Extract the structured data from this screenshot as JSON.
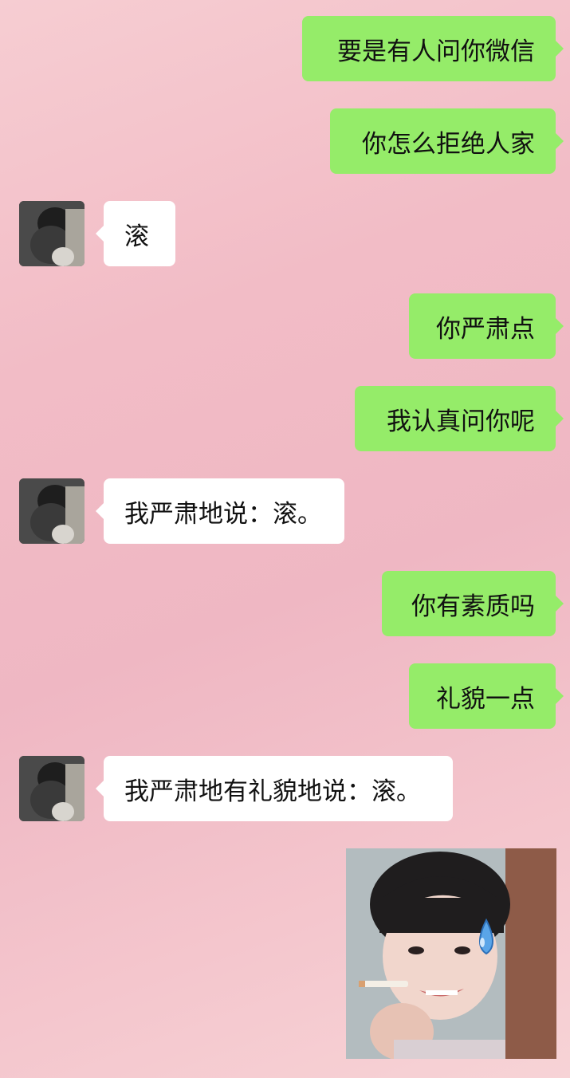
{
  "chat": {
    "messages": [
      {
        "side": "out",
        "text": "要是有人问你微信"
      },
      {
        "side": "out",
        "text": "你怎么拒绝人家"
      },
      {
        "side": "in",
        "text": "滚"
      },
      {
        "side": "out",
        "text": "你严肃点"
      },
      {
        "side": "out",
        "text": "我认真问你呢"
      },
      {
        "side": "in",
        "text": "我严肃地说：滚。"
      },
      {
        "side": "out",
        "text": "你有素质吗"
      },
      {
        "side": "out",
        "text": "礼貌一点"
      },
      {
        "side": "in",
        "text": "我严肃地有礼貌地说：滚。"
      }
    ],
    "sticker": {
      "description": "sweating-girl-sticker"
    },
    "colors": {
      "outgoing_bubble": "#95ec69",
      "incoming_bubble": "#ffffff",
      "background": "#f2bcc6"
    }
  }
}
